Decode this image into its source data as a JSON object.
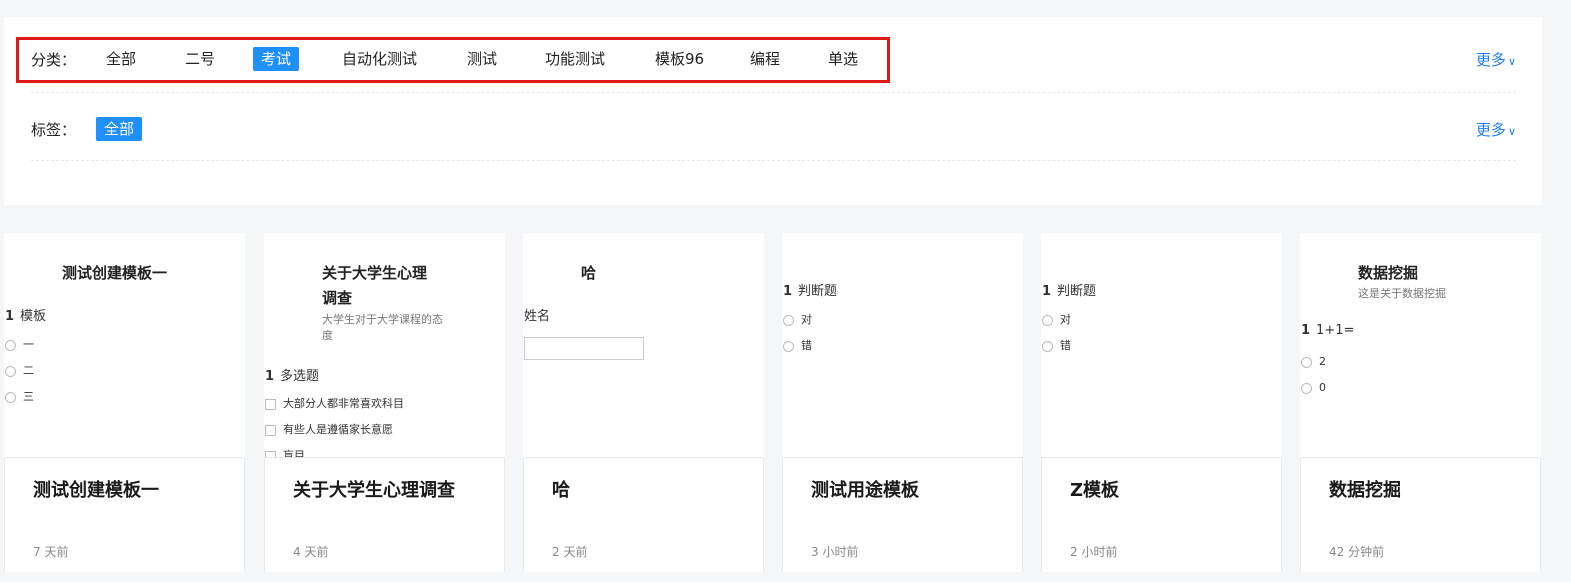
{
  "filters": {
    "category_label": "分类：",
    "categories": [
      "全部",
      "二号",
      "考试",
      "自动化测试",
      "测试",
      "功能测试",
      "模板96",
      "编程",
      "单选"
    ],
    "active_category": "考试",
    "tag_label": "标签：",
    "tags": [
      "全部"
    ],
    "more_label": "更多"
  },
  "cards": [
    {
      "title": "测试创建模板一",
      "time": "7 天前",
      "preview": {
        "title": "测试创建模板一",
        "question_no": "1",
        "question": "模板",
        "options": [
          "一",
          "二",
          "三"
        ]
      }
    },
    {
      "title": "关于大学生心理调查",
      "time": "4 天前",
      "preview": {
        "title_line1": "关于大学生心理",
        "title_line2": "调查",
        "subtitle_line1": "大学生对于大学课程的态",
        "subtitle_line2": "度",
        "question_no": "1",
        "question": "多选题",
        "options": [
          "大部分人都非常喜欢科目",
          "有些人是遵循家长意愿",
          "盲目"
        ]
      }
    },
    {
      "title": "哈",
      "time": "2 天前",
      "preview": {
        "title": "哈",
        "field_label": "姓名"
      }
    },
    {
      "title": "测试用途模板",
      "time": "3 小时前",
      "preview": {
        "question_no": "1",
        "question": "判断题",
        "options": [
          "对",
          "错"
        ]
      }
    },
    {
      "title": "Z模板",
      "time": "2 小时前",
      "preview": {
        "question_no": "1",
        "question": "判断题",
        "options": [
          "对",
          "错"
        ]
      }
    },
    {
      "title": "数据挖掘",
      "time": "42 分钟前",
      "preview": {
        "title": "数据挖掘",
        "subtitle": "这是关于数据挖掘",
        "question_no": "1",
        "question": "1+1=",
        "options": [
          "2",
          "0"
        ]
      }
    }
  ],
  "colors": {
    "accent": "#1f8ffb",
    "highlight": "#e01818",
    "link": "#1e7ef0"
  }
}
